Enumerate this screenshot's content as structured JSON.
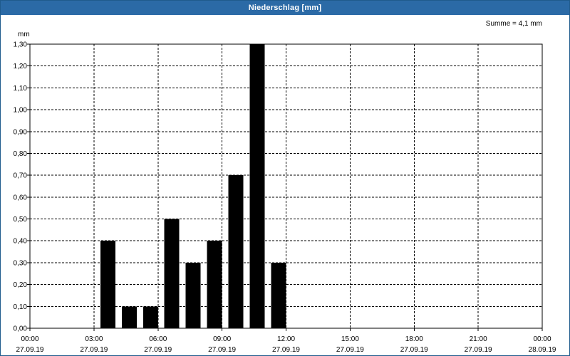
{
  "window": {
    "title": "Niederschlag [mm]"
  },
  "chart_data": {
    "type": "bar",
    "title": "Niederschlag [mm]",
    "ylabel": "mm",
    "annotation": "Summe = 4,1 mm",
    "ylim": [
      0,
      1.3
    ],
    "y_ticks": [
      "0,00",
      "0,10",
      "0,20",
      "0,30",
      "0,40",
      "0,50",
      "0,60",
      "0,70",
      "0,80",
      "0,90",
      "1,00",
      "1,10",
      "1,20",
      "1,30"
    ],
    "x_range_hours": [
      0,
      24
    ],
    "x_ticks": [
      {
        "time": "00:00",
        "date": "27.09.19"
      },
      {
        "time": "03:00",
        "date": "27.09.19"
      },
      {
        "time": "06:00",
        "date": "27.09.19"
      },
      {
        "time": "09:00",
        "date": "27.09.19"
      },
      {
        "time": "12:00",
        "date": "27.09.19"
      },
      {
        "time": "15:00",
        "date": "27.09.19"
      },
      {
        "time": "18:00",
        "date": "27.09.19"
      },
      {
        "time": "21:00",
        "date": "27.09.19"
      },
      {
        "time": "00:00",
        "date": "28.09.19"
      }
    ],
    "x": [
      "04:00",
      "05:00",
      "06:00",
      "07:00",
      "08:00",
      "09:00",
      "10:00",
      "11:00",
      "12:00"
    ],
    "values": [
      0.4,
      0.1,
      0.1,
      0.5,
      0.3,
      0.4,
      0.7,
      1.3,
      0.3
    ],
    "bar_color": "#000000",
    "grid": true,
    "grid_style": "dashed"
  }
}
